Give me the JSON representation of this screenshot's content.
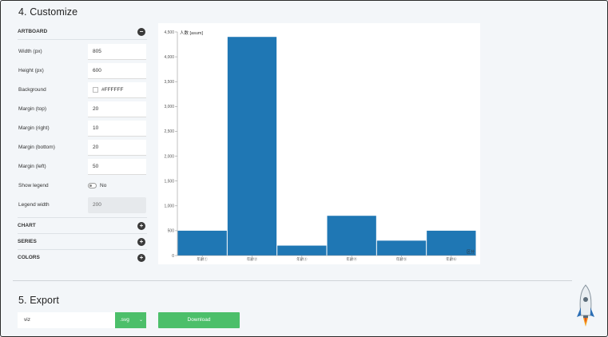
{
  "customize_title": "4. Customize",
  "export_title": "5. Export",
  "artboard": {
    "label": "ARTBOARD",
    "toggle": "−",
    "rows": [
      {
        "label": "Width (px)",
        "value": "805"
      },
      {
        "label": "Height (px)",
        "value": "600"
      },
      {
        "label": "Background",
        "value": "#FFFFFF"
      },
      {
        "label": "Margin (top)",
        "value": "20"
      },
      {
        "label": "Margin (right)",
        "value": "10"
      },
      {
        "label": "Margin (bottom)",
        "value": "20"
      },
      {
        "label": "Margin (left)",
        "value": "50"
      },
      {
        "label": "Show legend",
        "value": "No"
      },
      {
        "label": "Legend width",
        "value": "200"
      }
    ]
  },
  "sections": [
    {
      "label": "CHART",
      "toggle": "+"
    },
    {
      "label": "SERIES",
      "toggle": "+"
    },
    {
      "label": "COLORS",
      "toggle": "+"
    }
  ],
  "export": {
    "filename": "viz",
    "format": ".svg",
    "format_caret": "⌄",
    "download": "Download"
  },
  "colors": {
    "bar": "#1f77b4",
    "button": "#4cbf6a"
  },
  "icons": {
    "rocket": "rocket-icon"
  },
  "chart_data": {
    "type": "bar",
    "ylabel": "人数 [asum]",
    "corner_label": "区分",
    "categories": [
      "年齢①",
      "年齢②",
      "年齢③",
      "年齢④",
      "年齢⑤",
      "年齢⑥"
    ],
    "values": [
      500,
      4400,
      200,
      800,
      300,
      500
    ],
    "ylim": [
      0,
      4500
    ],
    "yticks": [
      0,
      500,
      1000,
      1500,
      2000,
      2500,
      3000,
      3500,
      4000,
      4500
    ],
    "ytick_labels": [
      "0",
      "500",
      "1,000",
      "1,500",
      "2,000",
      "2,500",
      "3,000",
      "3,500",
      "4,000",
      "4,500"
    ],
    "grid": false
  }
}
